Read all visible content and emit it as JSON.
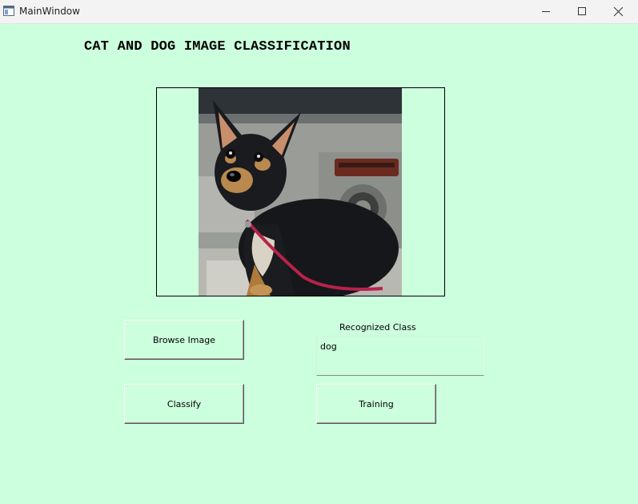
{
  "window": {
    "title": "MainWindow",
    "controls": {
      "minimize": "minimize",
      "maximize": "maximize",
      "close": "close"
    }
  },
  "app": {
    "heading": "CAT AND DOG IMAGE CLASSIFICATION",
    "image_alt": "dog",
    "buttons": {
      "browse": "Browse Image",
      "classify": "Classify",
      "training": "Training"
    },
    "result": {
      "label": "Recognized Class",
      "value": "dog"
    }
  },
  "colors": {
    "background": "#ccffdd",
    "titlebar": "#f3f3f3"
  }
}
